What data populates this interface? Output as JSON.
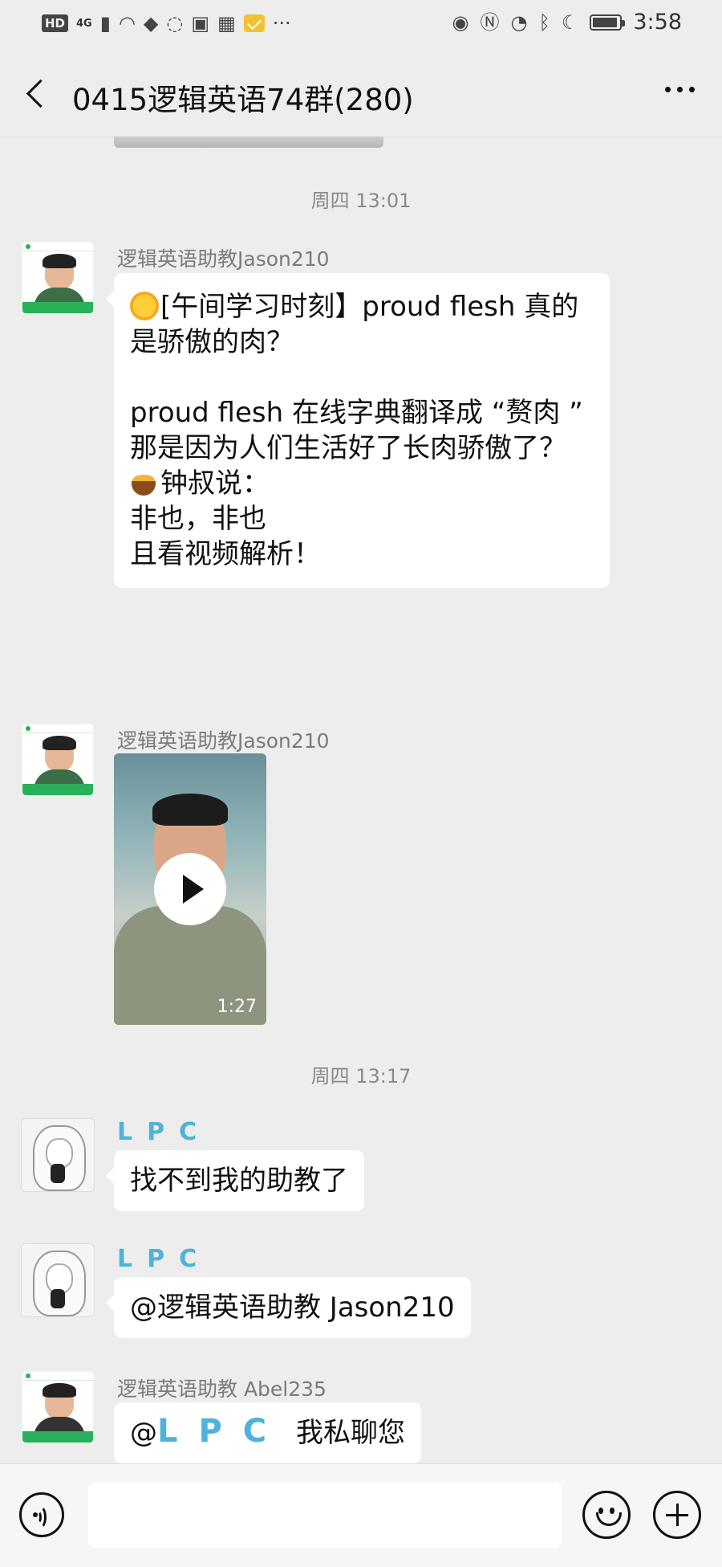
{
  "status_bar": {
    "hd": "HD",
    "network": "4G",
    "more_dots": "···",
    "time": "3:58"
  },
  "header": {
    "title": "0415逻辑英语74群(280)"
  },
  "messages": {
    "ts1": "周四 13:01",
    "m1_sender": "逻辑英语助教Jason210",
    "m1_line1": "[午间学习时刻】proud flesh 真的是骄傲的肉？",
    "m1_line2": "proud flesh 在线字典翻译成 “赘肉 ” 那是因为人们生活好了长肉骄傲了？",
    "m1_line3": "钟叔说：",
    "m1_line4": "非也，非也",
    "m1_line5": "且看视频解析！",
    "m2_sender": "逻辑英语助教Jason210",
    "video_duration": "1:27",
    "ts2": "周四 13:17",
    "m3_sender": "LPC",
    "m3_text": "找不到我的助教了",
    "m4_sender": "LPC",
    "m4_text": "@逻辑英语助教 Jason210",
    "m5_sender": "逻辑英语助教 Abel235",
    "m5_at": "@",
    "m5_mention": "LPC",
    "m5_text": " 我私聊您"
  },
  "input": {
    "placeholder": ""
  },
  "icons": {
    "back": "back-arrow-icon",
    "more": "more-dots-icon",
    "voice": "voice-icon",
    "emoji": "emoji-icon",
    "plus": "plus-icon"
  }
}
